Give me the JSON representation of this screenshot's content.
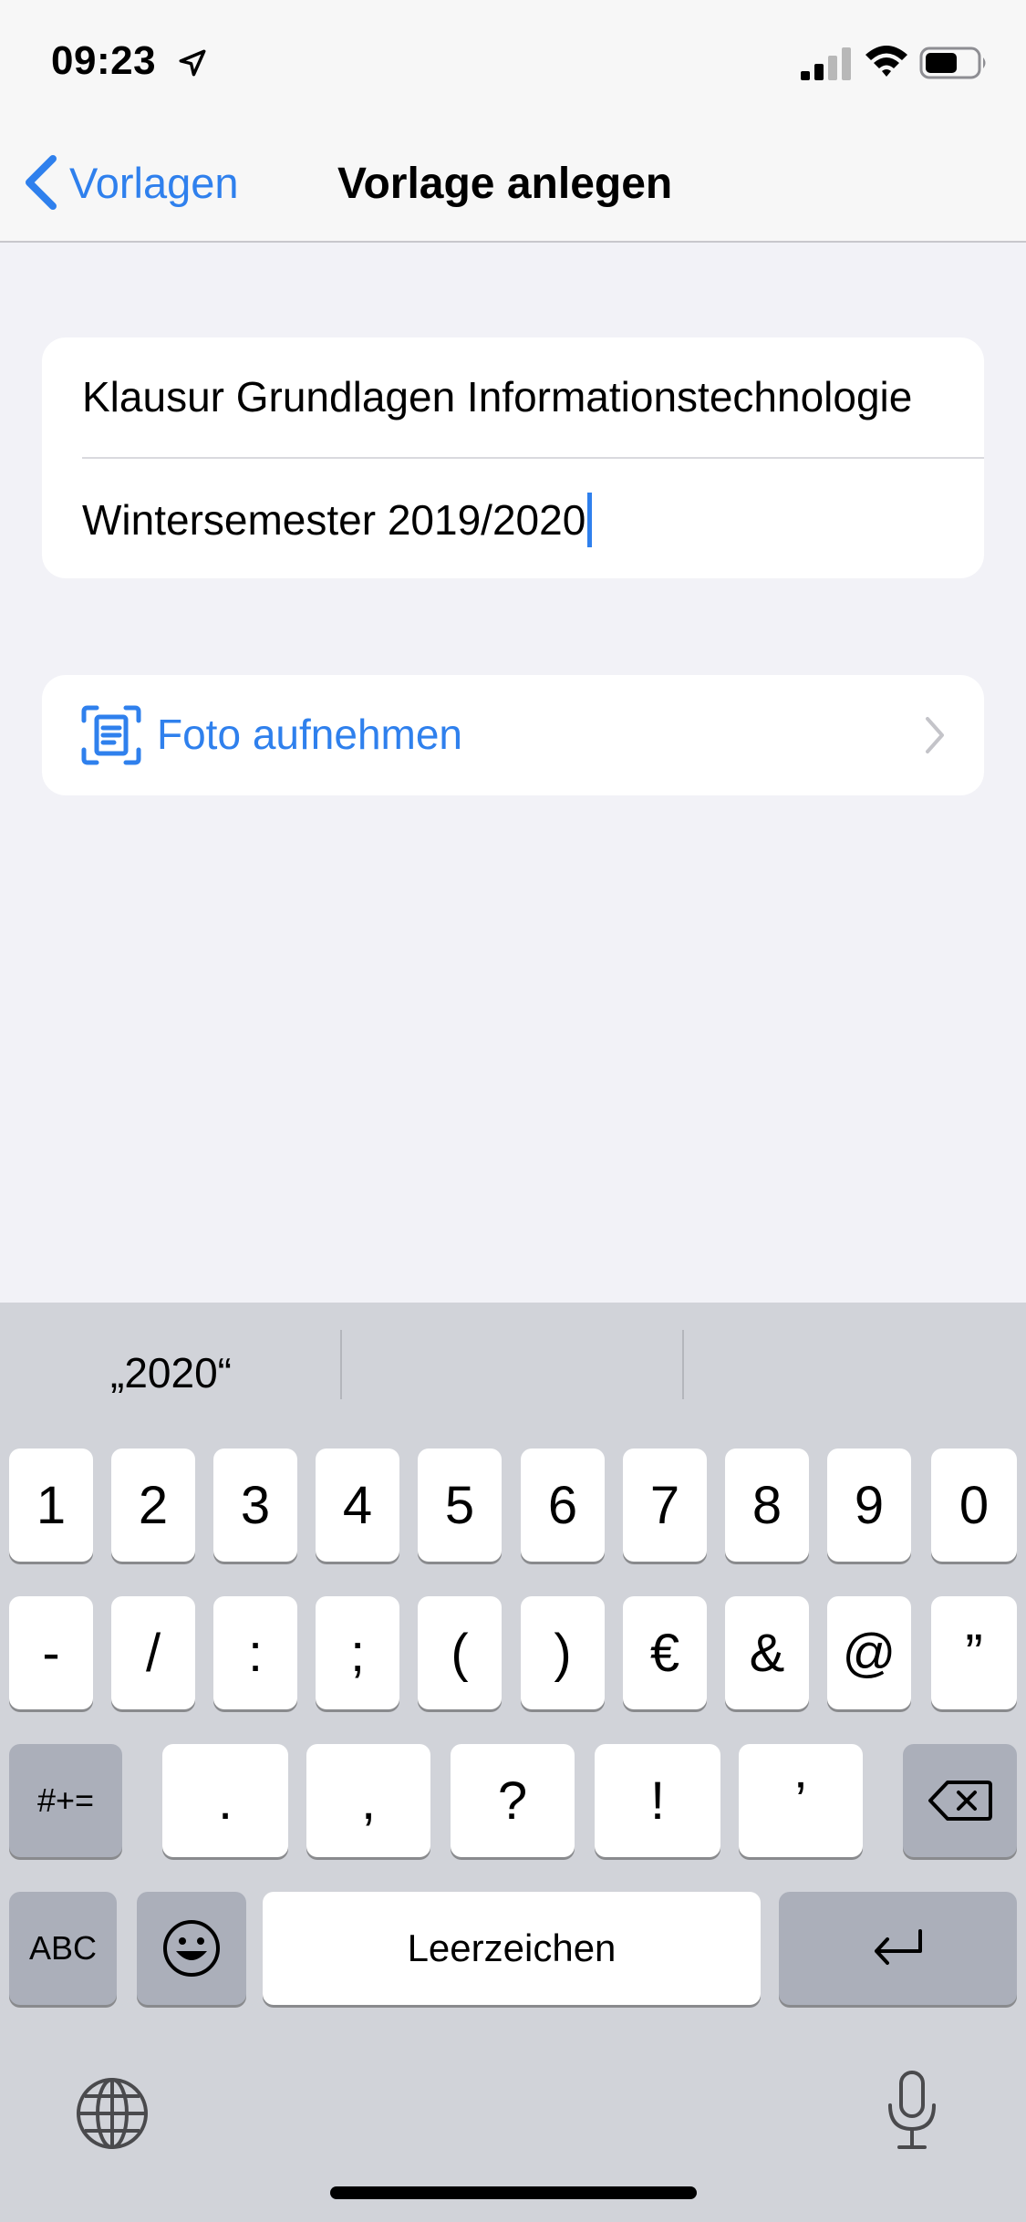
{
  "status_bar": {
    "time": "09:23",
    "icons": [
      "location-arrow-icon",
      "cellular-signal-icon",
      "wifi-icon",
      "battery-icon"
    ]
  },
  "nav": {
    "back_label": "Vorlagen",
    "title": "Vorlage anlegen"
  },
  "form": {
    "title_value": "Klausur Grundlagen Informationstechnologie",
    "subtitle_value": "Wintersemester 2019/2020"
  },
  "photo_row": {
    "label": "Foto aufnehmen",
    "icon": "document-scan-icon"
  },
  "keyboard": {
    "suggestions": [
      "„2020“",
      "",
      ""
    ],
    "row1": [
      "1",
      "2",
      "3",
      "4",
      "5",
      "6",
      "7",
      "8",
      "9",
      "0"
    ],
    "row2": [
      "-",
      "/",
      ":",
      ";",
      "(",
      ")",
      "€",
      "&",
      "@",
      "”"
    ],
    "row3": [
      "#+=",
      ".",
      ",",
      "?",
      "!",
      "’"
    ],
    "abc_label": "ABC",
    "space_label": "Leerzeichen",
    "icons": [
      "backspace-icon",
      "emoji-icon",
      "return-icon",
      "globe-icon",
      "microphone-icon"
    ]
  },
  "colors": {
    "accent": "#2f80ed",
    "background": "#f2f2f7",
    "keyboard_background": "#d1d3d9",
    "key_gray": "#abafba"
  }
}
